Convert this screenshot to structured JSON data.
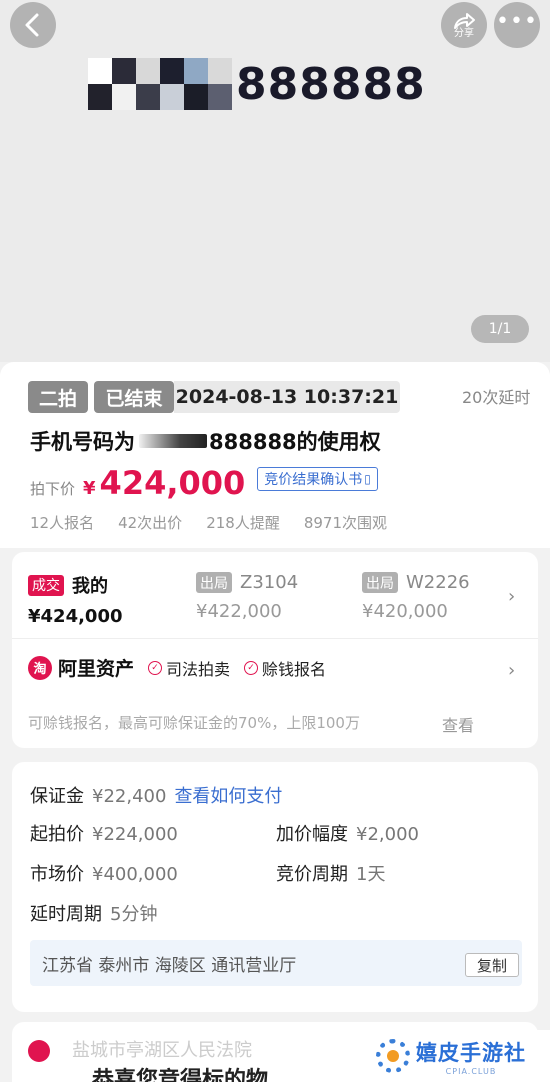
{
  "header": {
    "share_label": "分享",
    "back_icon": "chevron-left-icon",
    "more_icon": "ellipsis-icon",
    "phone_number_visible": "888888",
    "page_indicator": "1/1"
  },
  "auction": {
    "round_tag": "二拍",
    "status_tag": "已结束",
    "end_time": "2024-08-13 10:37:21",
    "delay_count": "20次延时",
    "title_prefix": "手机号码为",
    "title_suffix": "888888的使用权",
    "final_price_label": "拍下价",
    "currency": "¥",
    "final_price": "424,000",
    "certificate_button": "竞价结果确认书",
    "stats": [
      "12人报名",
      "42次出价",
      "218人提醒",
      "8971次围观"
    ]
  },
  "bids": [
    {
      "badge": "成交",
      "bidder": "我的",
      "amount": "¥424,000"
    },
    {
      "badge": "出局",
      "bidder": "Z3104",
      "amount": "¥422,000"
    },
    {
      "badge": "出局",
      "bidder": "W2226",
      "amount": "¥420,000"
    }
  ],
  "ali": {
    "logo_text": "淘",
    "name": "阿里资产",
    "tags": [
      "司法拍卖",
      "赊钱报名"
    ],
    "note": "可赊钱报名，最高可赊保证金的70%，上限100万",
    "view_label": "查看"
  },
  "details": {
    "deposit_label": "保证金",
    "deposit_value": "¥22,400",
    "deposit_link": "查看如何支付",
    "start_price_label": "起拍价",
    "start_price_value": "¥224,000",
    "increment_label": "加价幅度",
    "increment_value": "¥2,000",
    "market_price_label": "市场价",
    "market_price_value": "¥400,000",
    "bid_period_label": "竞价周期",
    "bid_period_value": "1天",
    "delay_period_label": "延时周期",
    "delay_period_value": "5分钟",
    "address": "江苏省 泰州市 海陵区 通讯营业厅",
    "copy_label": "复制"
  },
  "bottom": {
    "line1": "盐城市亭湖区人民法院",
    "line2": "恭喜您竞得标的物"
  },
  "watermark": {
    "title": "嬉皮手游社",
    "sub": "CPIA.CLUB"
  },
  "colors": {
    "accent": "#e0144f",
    "link": "#3a6ed0"
  }
}
